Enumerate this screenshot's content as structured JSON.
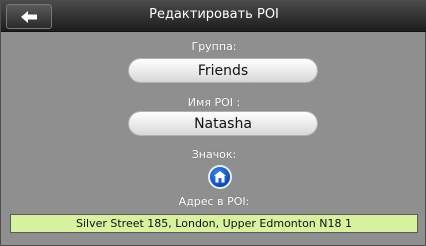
{
  "header": {
    "title": "Редактировать POI",
    "back_icon": "arrow-left-icon"
  },
  "group": {
    "label": "Группа:",
    "value": "Friends"
  },
  "poi_name": {
    "label": "Имя POI :",
    "value": "Natasha"
  },
  "icon": {
    "label": "Значок:",
    "icon_name": "house-icon",
    "color": "#1f5fd6"
  },
  "address": {
    "label": "Адрес в POI:",
    "value": "Silver Street 185, London, Upper Edmonton N18 1",
    "background": "#d9f2a0"
  }
}
